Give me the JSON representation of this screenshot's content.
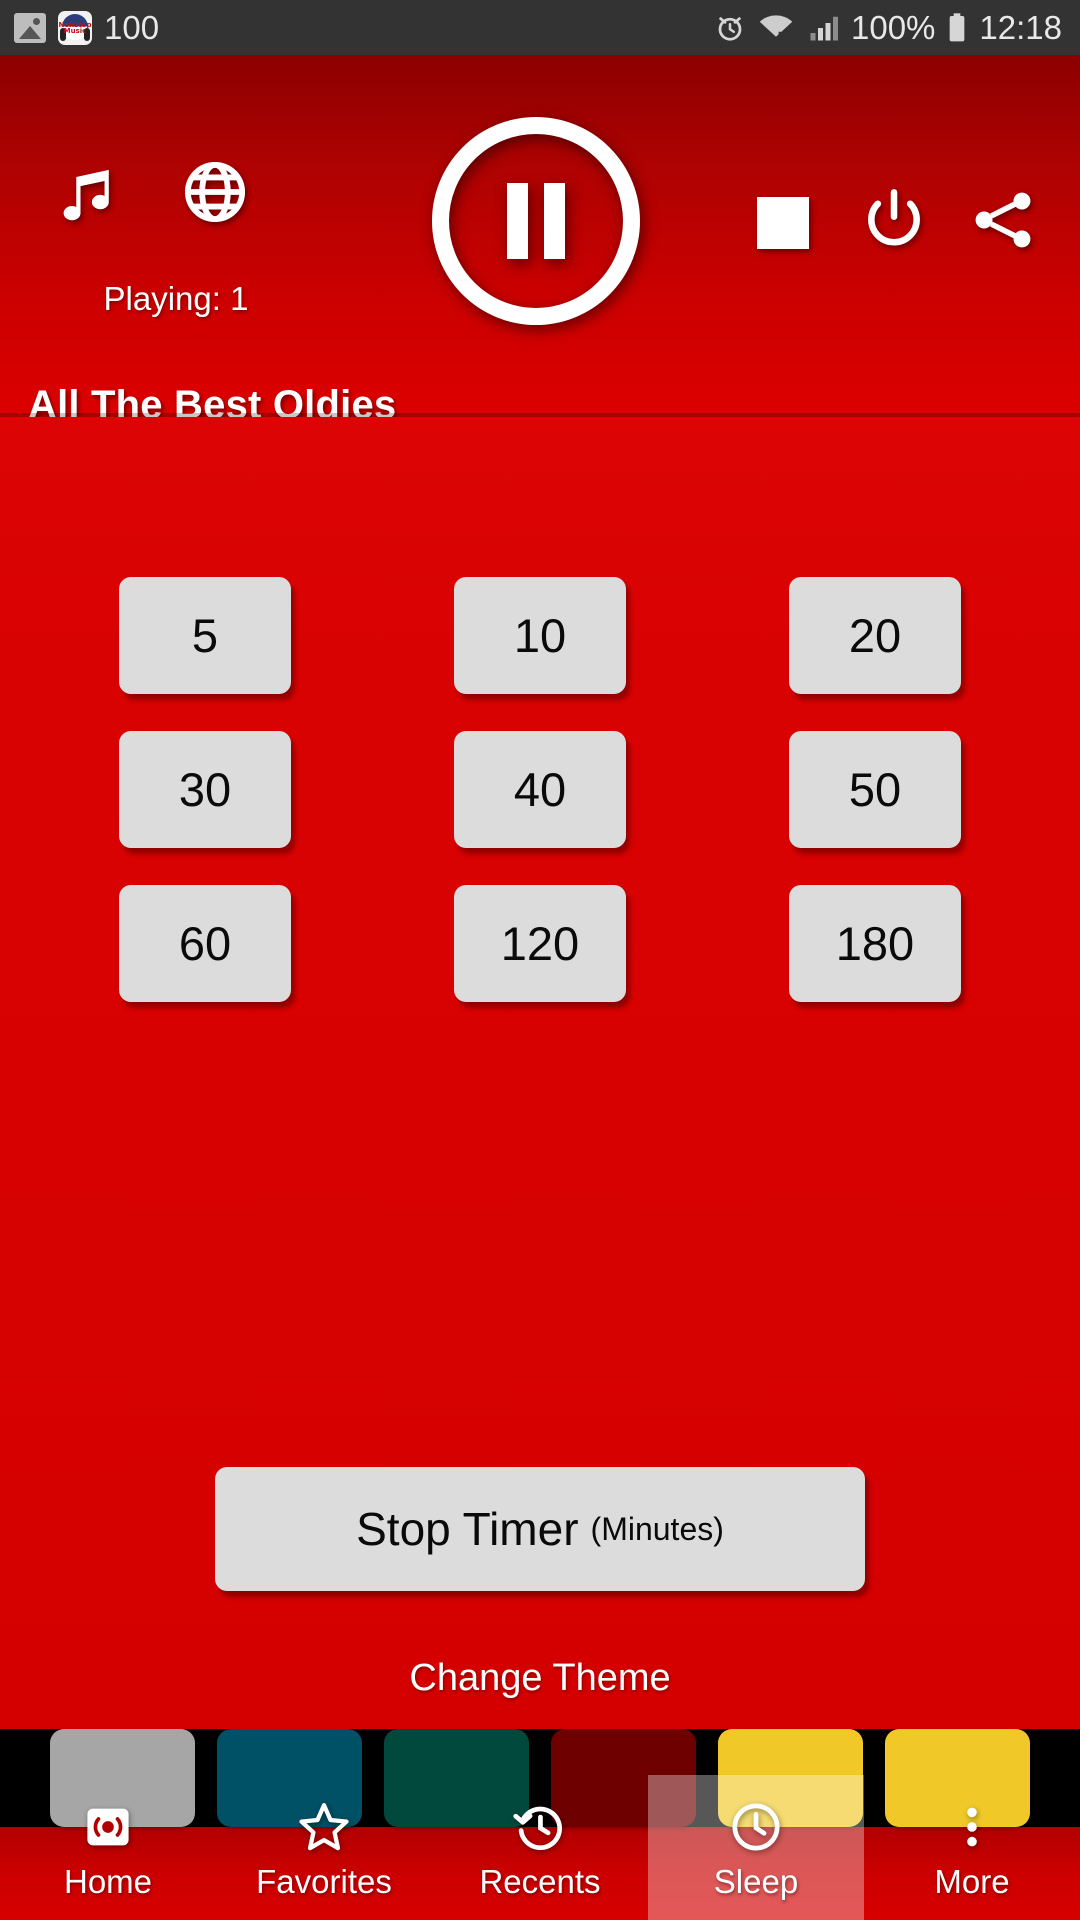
{
  "status_bar": {
    "battery_percent_left": "100",
    "battery_percent_right": "100%",
    "time": "12:18",
    "icons": [
      "photo-icon",
      "nonstop-music-app-icon",
      "alarm-icon",
      "wifi-icon",
      "signal-icon",
      "battery-icon"
    ],
    "app_badge_line1": "Nonstop",
    "app_badge_line2": "Music"
  },
  "header": {
    "playing_label": "Playing: 1",
    "station_title": "All The Best Oldies",
    "music_icon": "music-note-icon",
    "globe_icon": "globe-icon",
    "playpause_icon": "pause-icon",
    "stop_icon": "stop-square-icon",
    "power_icon": "power-icon",
    "share_icon": "share-icon"
  },
  "timers": {
    "rows": [
      [
        "5",
        "10",
        "20"
      ],
      [
        "30",
        "40",
        "50"
      ],
      [
        "60",
        "120",
        "180"
      ]
    ],
    "stop_timer_main": "Stop Timer",
    "stop_timer_sub": "(Minutes)"
  },
  "theme": {
    "title": "Change Theme",
    "swatches": [
      {
        "name": "black",
        "color": "#000000"
      },
      {
        "name": "gray",
        "color": "#A6A6A6"
      },
      {
        "name": "teal",
        "color": "#005066"
      },
      {
        "name": "green",
        "color": "#02493D"
      },
      {
        "name": "maroon",
        "color": "#6E0000"
      },
      {
        "name": "yellow",
        "color": "#F0C929"
      }
    ]
  },
  "bottom_nav": {
    "items": [
      {
        "label": "Home",
        "icon": "radio-icon",
        "active": false
      },
      {
        "label": "Favorites",
        "icon": "star-icon",
        "active": false
      },
      {
        "label": "Recents",
        "icon": "history-icon",
        "active": false
      },
      {
        "label": "Sleep",
        "icon": "clock-icon",
        "active": true
      },
      {
        "label": "More",
        "icon": "more-vert-icon",
        "active": false
      }
    ]
  },
  "colors": {
    "brand_red": "#D40000",
    "header_dark_red": "#8C0000",
    "button_gray": "#DCDCDC",
    "status_bar": "#333333"
  }
}
